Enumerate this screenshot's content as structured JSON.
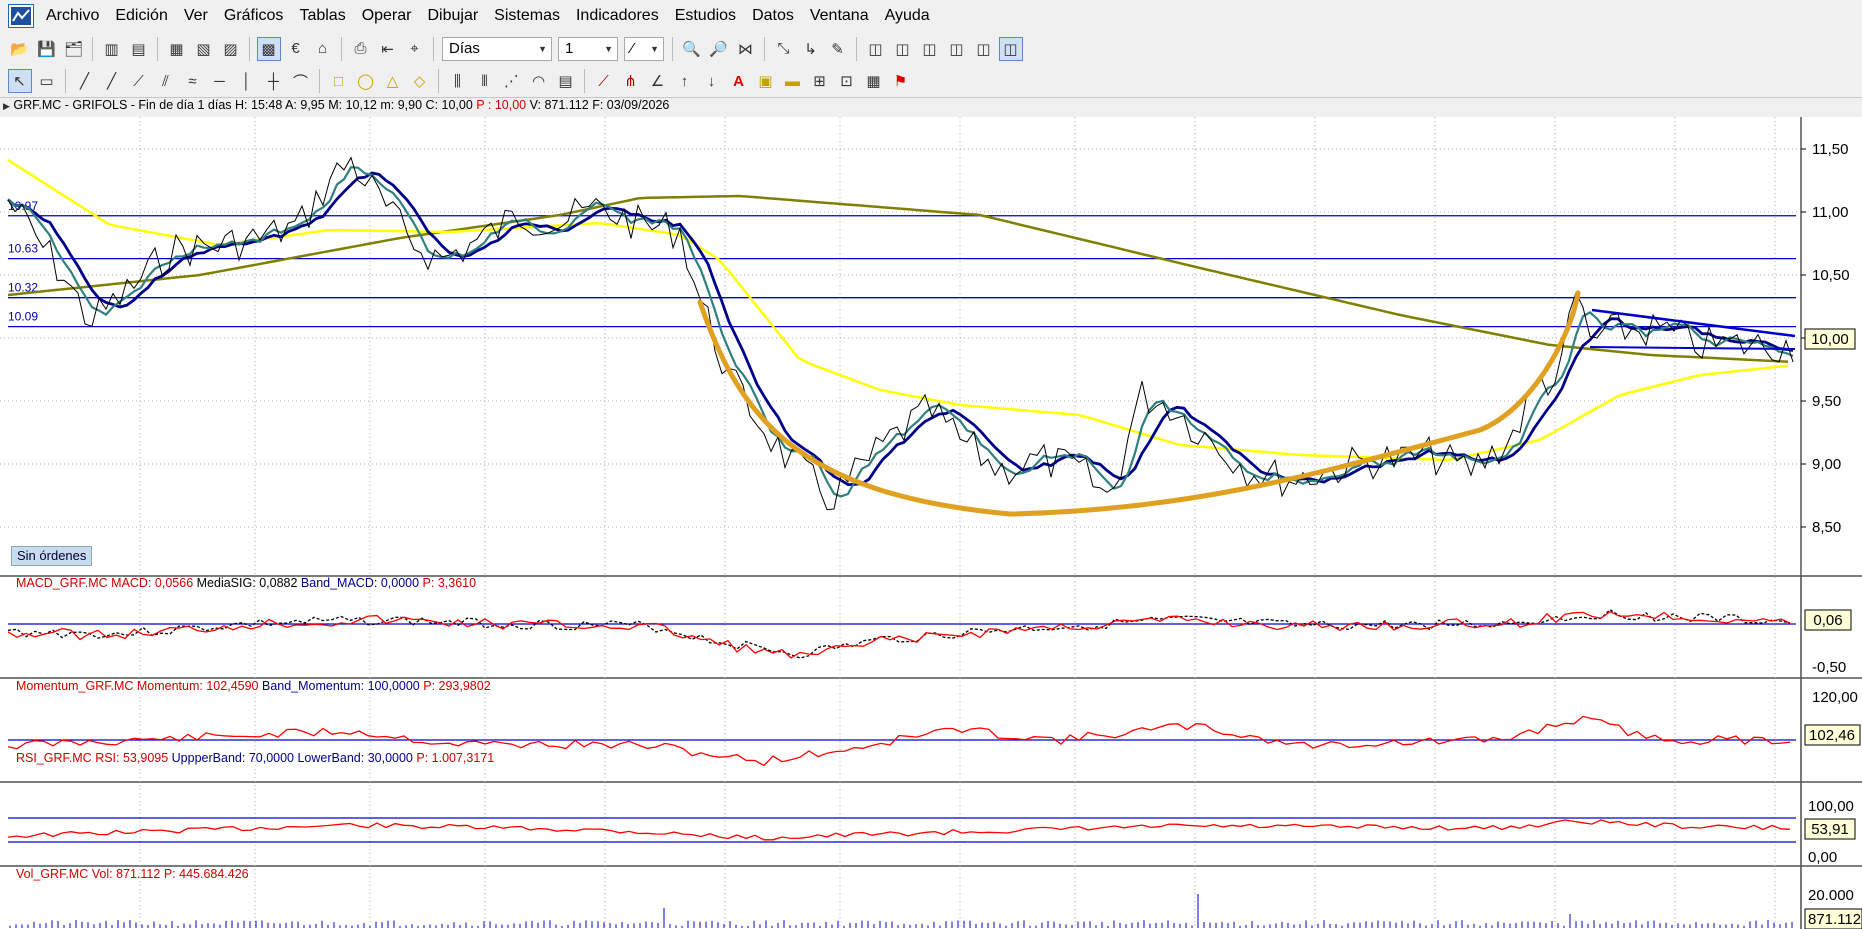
{
  "menu": [
    "Archivo",
    "Edición",
    "Ver",
    "Gráficos",
    "Tablas",
    "Operar",
    "Dibujar",
    "Sistemas",
    "Indicadores",
    "Estudios",
    "Datos",
    "Ventana",
    "Ayuda"
  ],
  "toolbar": {
    "period": "Días",
    "count": "1"
  },
  "header": {
    "symbol": "GRF.MC - GRIFOLS - Fin de día 1 días",
    "h_label": "H:",
    "h_val": "15:48",
    "a_label": "A:",
    "a_val": "9,95",
    "m_label": "M:",
    "m_val": "10,12",
    "min_label": "m:",
    "min_val": "9,90",
    "c_label": "C:",
    "c_val": "10,00",
    "p_label": "P :",
    "p_val": "10,00",
    "v_label": "V:",
    "v_val": "871.112",
    "f_label": "F:",
    "f_val": "03/09/2026"
  },
  "price_axis": [
    "11,50",
    "11,00",
    "10,50",
    "10,00",
    "9,50",
    "9,00",
    "8,50"
  ],
  "price_box": "10,00",
  "levels": [
    "10.97",
    "10.63",
    "10.32",
    "10.09"
  ],
  "sin_ordenes": "Sin órdenes",
  "macd": {
    "name": "MACD_GRF.MC",
    "l1": "MACD:",
    "v1": "0,0566",
    "l2": "MediaSIG:",
    "v2": "0,0882",
    "l3": "Band_MACD:",
    "v3": "0,0000",
    "l4": "P:",
    "v4": "3,3610",
    "axis": [
      "-0,50"
    ],
    "box": "0,06"
  },
  "momentum": {
    "name": "Momentum_GRF.MC",
    "l1": "Momentum:",
    "v1": "102,4590",
    "l2": "Band_Momentum:",
    "v2": "100,0000",
    "l3": "P:",
    "v3": "293,9802",
    "axis": [
      "120,00"
    ],
    "box": "102,46"
  },
  "rsi": {
    "name": "RSI_GRF.MC",
    "l1": "RSI:",
    "v1": "53,9095",
    "l2": "UppperBand:",
    "v2": "70,0000",
    "l3": "LowerBand:",
    "v3": "30,0000",
    "l4": "P:",
    "v4": "1.007,3171",
    "axis": [
      "100,00",
      "0,00"
    ],
    "box": "53,91"
  },
  "volume": {
    "name": "Vol_GRF.MC",
    "l1": "Vol:",
    "v1": "871.112",
    "l2": "P:",
    "v2": "445.684.426",
    "axis": [
      "20.000"
    ],
    "box": "871.112"
  },
  "colors": {
    "close": "#000000",
    "ma_fast": "#2f7f7f",
    "ma_mid": "#00008b",
    "ma_slow": "#ffff00",
    "ma_long": "#808000",
    "cup": "#e0a020",
    "level": "#0000cd",
    "indicator": "#ff0000"
  }
}
